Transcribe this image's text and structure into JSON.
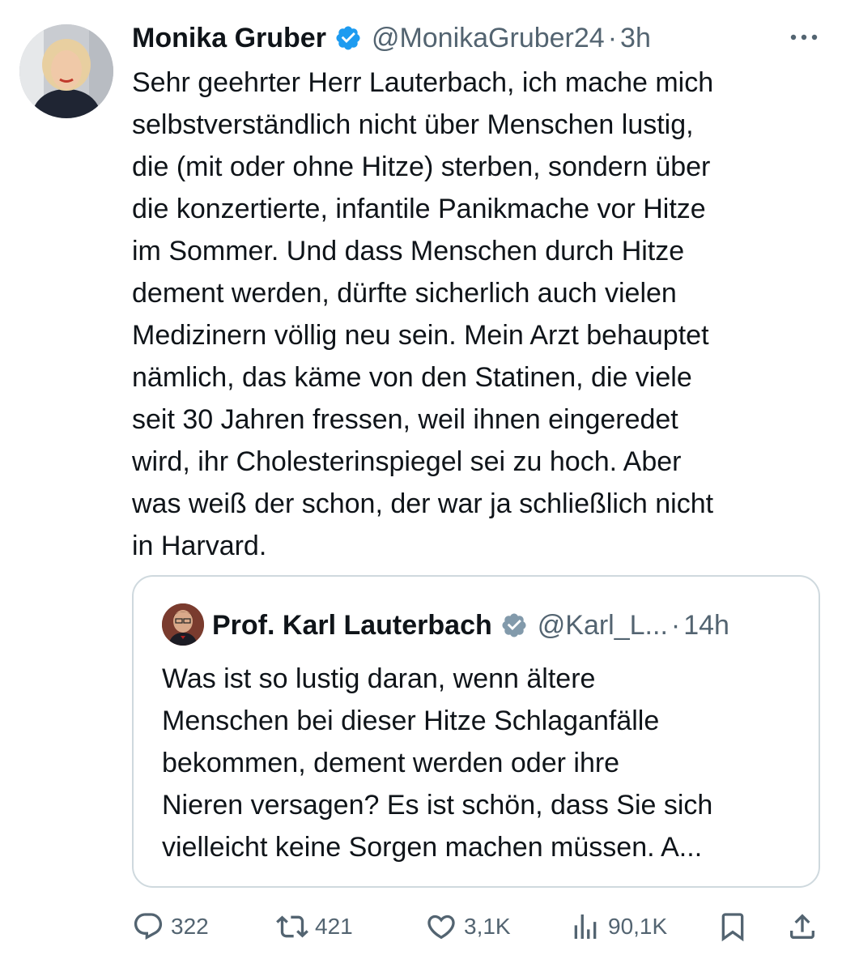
{
  "tweet": {
    "author_name": "Monika Gruber",
    "handle": "@MonikaGruber24",
    "separator": "·",
    "time": "3h",
    "text": "Sehr geehrter Herr Lauterbach, ich mache mich\nselbstverständlich nicht über Menschen lustig,\ndie (mit oder ohne Hitze) sterben, sondern über\ndie konzertierte, infantile Panikmache vor Hitze\nim Sommer. Und dass Menschen durch Hitze\ndement werden, dürfte sicherlich auch vielen\nMedizinern völlig neu sein. Mein Arzt behauptet\nnämlich, das käme von den Statinen, die viele\nseit 30 Jahren fressen, weil ihnen eingeredet\nwird, ihr Cholesterinspiegel sei zu hoch. Aber\nwas weiß der schon, der war ja schließlich nicht\nin Harvard."
  },
  "quote": {
    "author_name": "Prof. Karl Lauterbach",
    "handle": "@Karl_L...",
    "separator": "·",
    "time": "14h",
    "text": "Was ist so lustig daran, wenn ältere\nMenschen bei dieser Hitze Schlaganfälle\nbekommen, dement werden oder ihre\nNieren versagen? Es ist schön, dass Sie sich\nvielleicht keine Sorgen machen müssen. A..."
  },
  "actions": {
    "replies": "322",
    "reposts": "421",
    "likes": "3,1K",
    "views": "90,1K"
  },
  "icons": {
    "verified": "verified-badge-icon",
    "more": "more-icon",
    "reply": "reply-icon",
    "repost": "repost-icon",
    "like": "like-icon",
    "views": "views-icon",
    "bookmark": "bookmark-icon",
    "share": "share-icon"
  },
  "colors": {
    "verified_primary": "#1d9bf0",
    "verified_quote": "#829aab",
    "text": "#0f1419",
    "secondary": "#536471",
    "border": "#cfd9de"
  }
}
